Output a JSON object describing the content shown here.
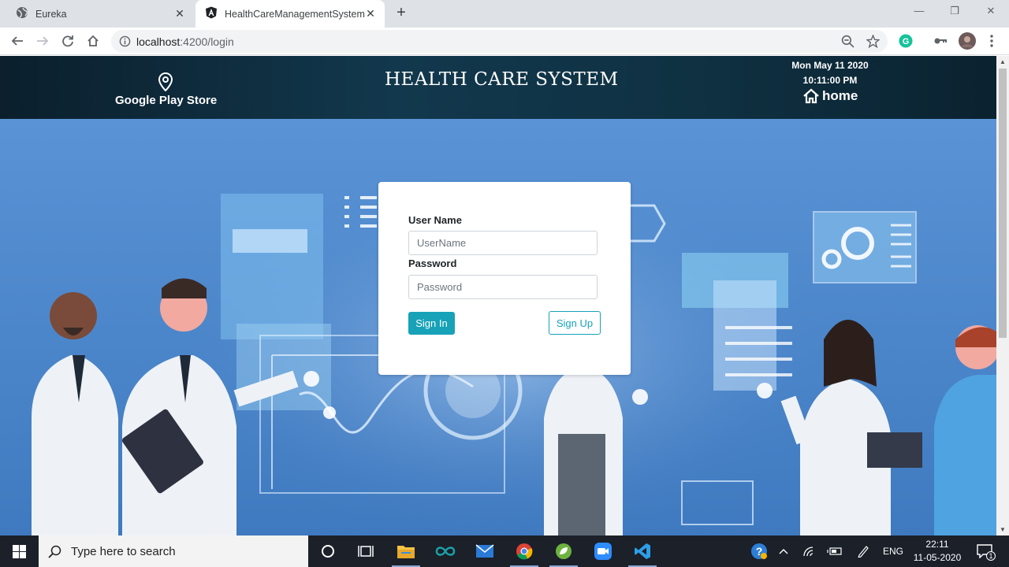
{
  "browser": {
    "tabs": [
      {
        "title": "Eureka",
        "close": "✕"
      },
      {
        "title": "HealthCareManagementSystem",
        "close": "✕"
      }
    ],
    "new_tab": "+",
    "url_host": "localhost",
    "url_path": ":4200/login",
    "window_controls": [
      "—",
      "❐",
      "✕"
    ]
  },
  "header": {
    "left_link": "Google Play Store",
    "title": "HEALTH CARE SYSTEM",
    "date": "Mon May 11 2020",
    "time": "10:11:00 PM",
    "home_link": "home"
  },
  "login": {
    "username_label": "User Name",
    "username_placeholder": "UserName",
    "password_label": "Password",
    "password_placeholder": "Password",
    "signin_label": "Sign In",
    "signup_label": "Sign Up"
  },
  "taskbar": {
    "search_placeholder": "Type here to search",
    "language": "ENG",
    "time": "22:11",
    "date": "11-05-2020",
    "notification_count": "1"
  },
  "colors": {
    "accent": "#17a2b8",
    "header_bg": "#0f3142",
    "page_bg": "#4c86c8",
    "taskbar_bg": "#1b2029"
  }
}
